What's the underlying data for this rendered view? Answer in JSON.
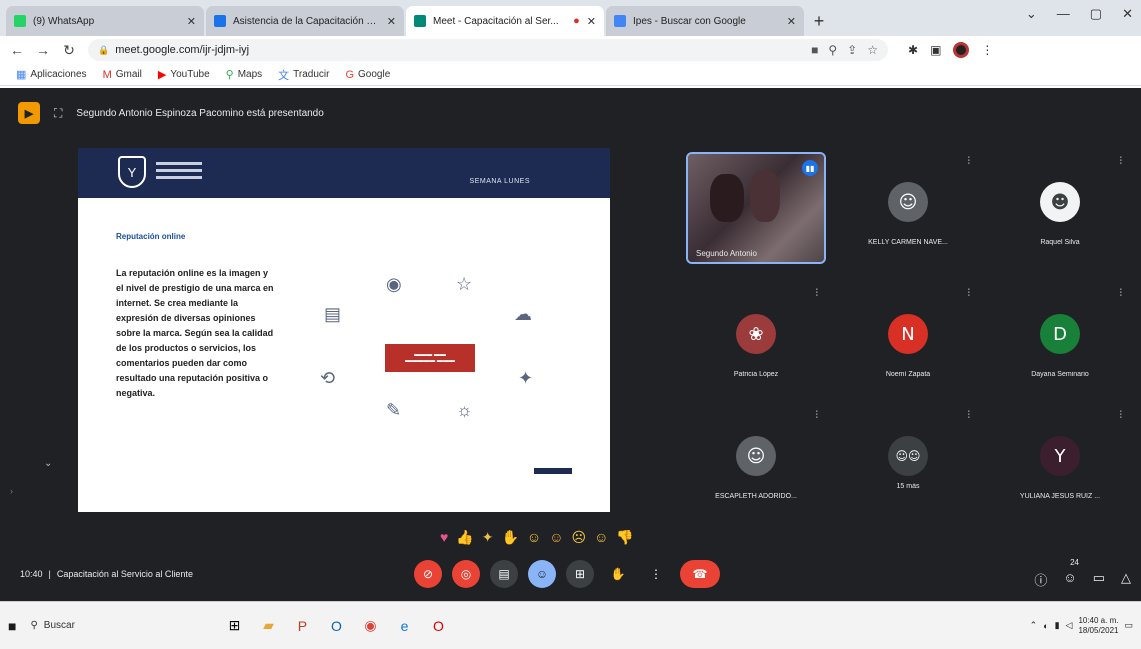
{
  "browser": {
    "tabs": [
      {
        "title": "(9) WhatsApp",
        "color": "#25d366"
      },
      {
        "title": "Asistencia de la Capacitación y C...",
        "color": "#1a73e8"
      },
      {
        "title": "Meet - Capacitación al Ser...",
        "color": "#00897b"
      },
      {
        "title": "Ipes - Buscar con Google",
        "color": "#4285f4"
      }
    ],
    "new_tab": "+",
    "address": "meet.google.com/ijr-jdjm-iyj",
    "bookmarks": [
      {
        "label": "Aplicaciones",
        "icon": "apps-icon"
      },
      {
        "label": "Gmail",
        "icon": "gmail-icon"
      },
      {
        "label": "YouTube",
        "icon": "youtube-icon"
      },
      {
        "label": "Maps",
        "icon": "maps-icon"
      },
      {
        "label": "Traducir",
        "icon": "translate-icon"
      },
      {
        "label": "Google",
        "icon": "google-icon"
      }
    ]
  },
  "meet": {
    "presenting": "Segundo Antonio Espinoza Pacomino está presentando",
    "slide": {
      "tag": "SEMANA LUNES",
      "subtitle": "Reputación online",
      "body": "La reputación online es la imagen y el nivel de prestigio de una marca en internet. Se crea mediante la expresión de diversas opiniones sobre la marca. Según sea la calidad de los productos o servicios, los comentarios pueden dar como resultado una reputación positiva o negativa."
    },
    "participants": [
      {
        "name": "Segundo Antonio",
        "initial": "",
        "color": ""
      },
      {
        "name": "KELLY CARMEN NAVE...",
        "initial": "",
        "color": "#5f6368"
      },
      {
        "name": "Raquel Silva",
        "initial": "",
        "color": "#5f6368"
      },
      {
        "name": "Patricia López",
        "initial": "",
        "color": "#9c3b3b"
      },
      {
        "name": "Noemí Zapata",
        "initial": "N",
        "color": "#d93025"
      },
      {
        "name": "Dayana Seminario",
        "initial": "D",
        "color": "#188038"
      },
      {
        "name": "ESCAPLETH ADORIDO...",
        "initial": "",
        "color": "#5f6368"
      },
      {
        "name": "15 más",
        "initial": "",
        "color": "#3c4043"
      },
      {
        "name": "YULIANA JESUS RUIZ ...",
        "initial": "Y",
        "color": "#3c1f2e"
      }
    ],
    "time": "10:40",
    "meeting_title": "Capacitación al Servicio al Cliente",
    "participant_count": "24"
  },
  "taskbar": {
    "search_placeholder": "Buscar",
    "clock_time": "10:40 a. m.",
    "clock_date": "18/05/2021"
  }
}
